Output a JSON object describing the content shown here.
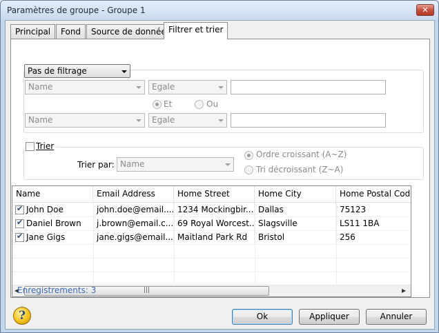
{
  "window": {
    "title": "Paramètres de groupe - Groupe 1",
    "close_label": "✕"
  },
  "tabs": [
    {
      "label": "Principal"
    },
    {
      "label": "Fond"
    },
    {
      "label": "Source de données"
    },
    {
      "label": "Filtrer et trier"
    }
  ],
  "filter": {
    "mode": "Pas de filtrage",
    "row1": {
      "field": "Name",
      "operator": "Egale",
      "value": ""
    },
    "row2": {
      "field": "Name",
      "operator": "Egale",
      "value": ""
    },
    "and_label": "Et",
    "or_label": "Ou"
  },
  "sort": {
    "checkbox_label": "Trier",
    "sort_by_label": "Trier par:",
    "sort_by_value": "Name",
    "ascending_label": "Ordre croissant (A~Z)",
    "descending_label": "Tri décroissant (Z~A)"
  },
  "grid": {
    "columns": [
      "Name",
      "Email Address",
      "Home Street",
      "Home City",
      "Home Postal Code"
    ],
    "rows": [
      {
        "name": "John Doe",
        "email": "john.doe@email....",
        "street": "1234 Mockingbir...",
        "city": "Dallas",
        "postal": "75123"
      },
      {
        "name": "Daniel Brown",
        "email": "j.brown@email.c...",
        "street": "69 Royal Worcest...",
        "city": "Slagsville",
        "postal": "LS11 1BA"
      },
      {
        "name": "Jane Gigs",
        "email": "jane.gigs@email....",
        "street": "Maitland Park Rd",
        "city": "Bristol",
        "postal": "256"
      }
    ],
    "scroll_left": "◂",
    "scroll_right": "▸",
    "scroll_grip": "|||"
  },
  "records_label": "Enregistrements: 3",
  "buttons": {
    "ok": "Ok",
    "apply": "Appliquer",
    "cancel": "Annuler"
  },
  "help_glyph": "?"
}
